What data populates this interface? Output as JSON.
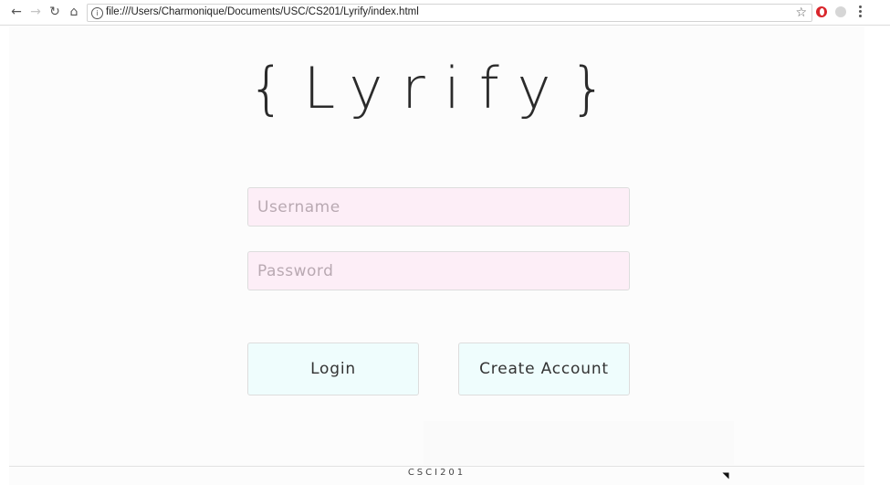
{
  "browser": {
    "url": "file:///Users/Charmonique/Documents/USC/CS201/Lyrify/index.html",
    "icons": {
      "back": "back-arrow-icon",
      "forward": "forward-arrow-icon",
      "reload": "reload-icon",
      "home": "home-icon",
      "info": "info-icon",
      "bookmark": "star-icon",
      "extension_1": "opera-extension-icon",
      "extension_2": "gray-extension-icon",
      "menu": "kebab-menu-icon"
    }
  },
  "app": {
    "logo": "{Lyrify}",
    "login_form": {
      "username_placeholder": "Username",
      "password_placeholder": "Password",
      "login_label": "Login",
      "create_account_label": "Create Account"
    },
    "footer": "CSCI201"
  },
  "colors": {
    "input_background": "#fdeef7",
    "button_background": "#effdfd",
    "logo_text": "#2b2b2b"
  }
}
